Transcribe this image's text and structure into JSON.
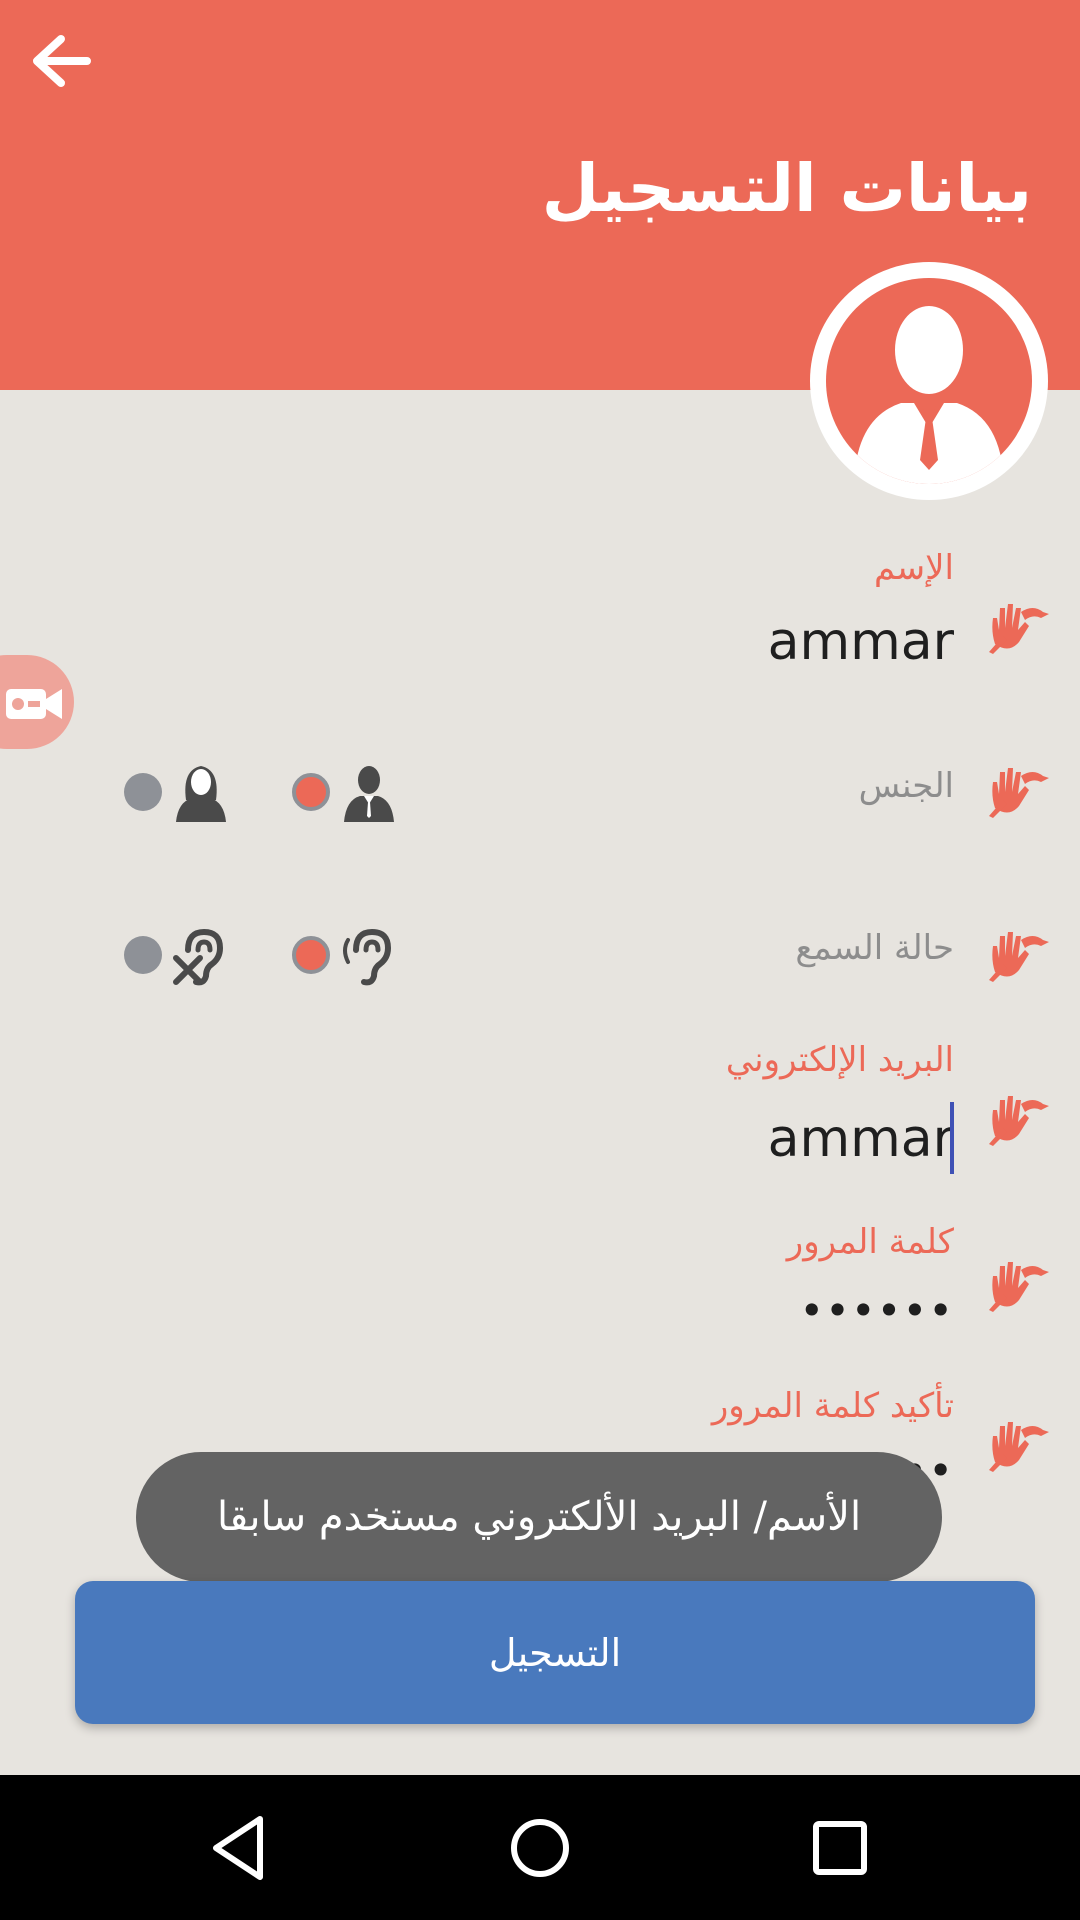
{
  "header": {
    "title": "بيانات التسجيل"
  },
  "form": {
    "name": {
      "label": "الإسم",
      "value": "ammar"
    },
    "gender": {
      "label": "الجنس",
      "male_selected": true,
      "female_selected": false
    },
    "hearing": {
      "label": "حالة السمع",
      "hearing_selected": true,
      "deaf_selected": false
    },
    "email": {
      "label": "البريد الإلكتروني",
      "value": "ammar"
    },
    "password": {
      "label": "كلمة المرور",
      "value": "••••••"
    },
    "confirm_password": {
      "label": "تأكيد كلمة المرور",
      "value": "••••••"
    }
  },
  "toast": {
    "message": "الأسم/ البريد الألكتروني مستخدم سابقا"
  },
  "submit": {
    "label": "التسجيل"
  },
  "colors": {
    "accent": "#ec6957",
    "button": "#4979bd",
    "background": "#e7e4df",
    "toast": "#636363"
  },
  "icons": {
    "back": "arrow-left-icon",
    "avatar": "user-avatar-icon",
    "video": "video-camera-icon",
    "sign": "sign-language-hand-icon",
    "male": "male-user-icon",
    "female": "female-user-icon",
    "hearing": "ear-icon",
    "deaf": "ear-crossed-icon"
  }
}
